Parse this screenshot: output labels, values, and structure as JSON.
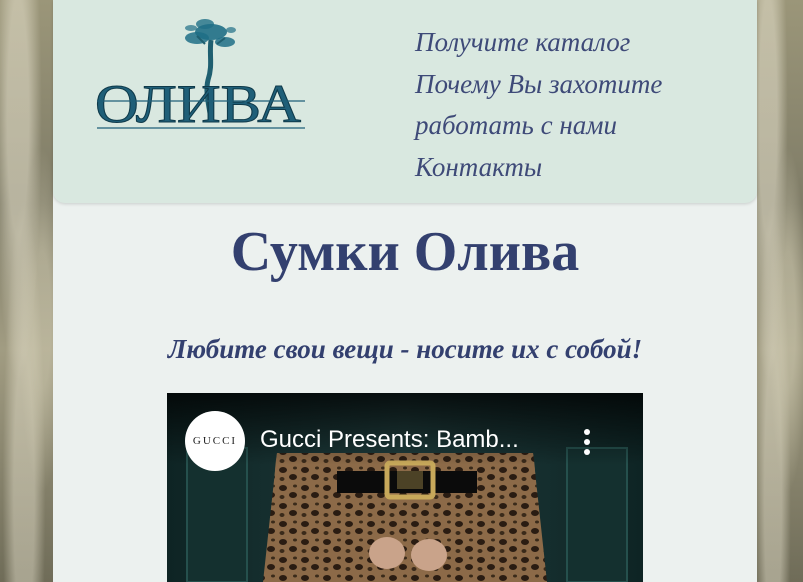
{
  "brand": {
    "logo_text": "ОЛИВА"
  },
  "nav": {
    "items": [
      {
        "label": "Получите каталог"
      },
      {
        "label": "Почему Вы захотите работать с нами"
      },
      {
        "label": "Контакты"
      }
    ]
  },
  "main": {
    "title": "Сумки Олива",
    "tagline": "Любите свои вещи - носите их с собой!"
  },
  "video": {
    "channel_badge": "GUCCI",
    "title": "Gucci Presents: Bamb..."
  },
  "colors": {
    "header_bg": "#d9e8e0",
    "page_bg": "#ecf1ef",
    "text_primary": "#33406f",
    "logo_teal": "#2a6f86"
  }
}
